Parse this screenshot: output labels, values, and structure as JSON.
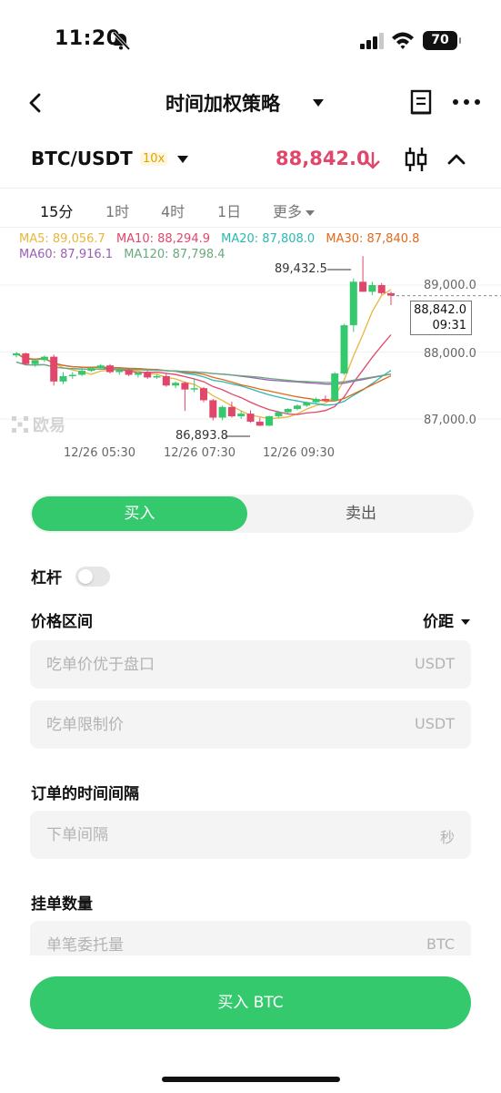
{
  "status_bar": {
    "time": "11:20",
    "battery": "70"
  },
  "nav": {
    "title": "时间加权策略"
  },
  "pair": {
    "name": "BTC/USDT",
    "leverage": "10x",
    "price": "88,842.0",
    "price_color": "#e0476b"
  },
  "timeframes": [
    "15分",
    "1时",
    "4时",
    "1日",
    "更多"
  ],
  "active_timeframe": "15分",
  "ma_legend": [
    {
      "label": "MA5: 89,056.7",
      "color": "#e8b63c"
    },
    {
      "label": "MA10: 88,294.9",
      "color": "#e0476b"
    },
    {
      "label": "MA20: 87,808.0",
      "color": "#2db8b0"
    },
    {
      "label": "MA30: 87,840.8",
      "color": "#e06a1a"
    },
    {
      "label": "MA60: 87,916.1",
      "color": "#9b5fb5"
    },
    {
      "label": "MA120: 87,798.4",
      "color": "#6aaa7c"
    }
  ],
  "chart_data": {
    "type": "candlestick",
    "pair": "BTC/USDT",
    "interval": "15分",
    "y_ticks": [
      89000.0,
      88000.0,
      87000.0
    ],
    "y_tick_labels": [
      "89,000.0",
      "88,000.0",
      "87,000.0"
    ],
    "x_tick_labels": [
      "12/26 05:30",
      "12/26 07:30",
      "12/26 09:30"
    ],
    "last_price_tag": [
      "88,842.0",
      "09:31"
    ],
    "high_marker": "89,432.5",
    "low_marker": "86,893.8",
    "up_color": "#35c96d",
    "down_color": "#e0476b",
    "candles_ohlc": [
      [
        87950,
        88000,
        87920,
        87980
      ],
      [
        87980,
        87990,
        87800,
        87820
      ],
      [
        87820,
        87900,
        87780,
        87880
      ],
      [
        87880,
        87950,
        87850,
        87930
      ],
      [
        87930,
        87960,
        87500,
        87560
      ],
      [
        87560,
        87700,
        87520,
        87640
      ],
      [
        87640,
        87700,
        87600,
        87660
      ],
      [
        87660,
        87760,
        87640,
        87720
      ],
      [
        87720,
        87780,
        87700,
        87760
      ],
      [
        87760,
        87820,
        87740,
        87800
      ],
      [
        87800,
        87820,
        87680,
        87700
      ],
      [
        87700,
        87740,
        87660,
        87730
      ],
      [
        87730,
        87760,
        87640,
        87660
      ],
      [
        87660,
        87700,
        87620,
        87690
      ],
      [
        87690,
        87720,
        87600,
        87620
      ],
      [
        87620,
        87660,
        87600,
        87640
      ],
      [
        87640,
        87680,
        87480,
        87500
      ],
      [
        87500,
        87560,
        87460,
        87540
      ],
      [
        87540,
        87560,
        87120,
        87440
      ],
      [
        87440,
        87600,
        87400,
        87460
      ],
      [
        87460,
        87480,
        87250,
        87280
      ],
      [
        87280,
        87300,
        86980,
        87020
      ],
      [
        87020,
        87200,
        86980,
        87180
      ],
      [
        87180,
        87260,
        87020,
        87040
      ],
      [
        87040,
        87120,
        87000,
        87080
      ],
      [
        87080,
        87130,
        86940,
        86960
      ],
      [
        86960,
        87020,
        86894,
        86900
      ],
      [
        86900,
        87050,
        86894,
        87040
      ],
      [
        87040,
        87120,
        87020,
        87100
      ],
      [
        87100,
        87160,
        87080,
        87150
      ],
      [
        87150,
        87220,
        87130,
        87200
      ],
      [
        87200,
        87260,
        87180,
        87250
      ],
      [
        87250,
        87320,
        87240,
        87300
      ],
      [
        87300,
        87350,
        87260,
        87280
      ],
      [
        87280,
        87700,
        87270,
        87680
      ],
      [
        87680,
        88420,
        87660,
        88400
      ],
      [
        88400,
        89100,
        88300,
        89050
      ],
      [
        89050,
        89432.5,
        88900,
        88900
      ],
      [
        88900,
        89050,
        88850,
        89000
      ],
      [
        89000,
        89030,
        88860,
        88880
      ],
      [
        88880,
        88900,
        88700,
        88842
      ]
    ]
  },
  "trade": {
    "buy_tab": "买入",
    "sell_tab": "卖出",
    "leverage_label": "杠杆",
    "price_range_label": "价格区间",
    "price_mode": "价距",
    "taker_price_placeholder": "吃单价优于盘口",
    "taker_limit_placeholder": "吃单限制价",
    "unit_usdt": "USDT",
    "interval_label": "订单的时间间隔",
    "interval_placeholder": "下单间隔",
    "interval_unit": "秒",
    "order_qty_label": "挂单数量",
    "order_qty_placeholder": "单笔委托量",
    "unit_btc": "BTC",
    "submit": "买入 BTC",
    "accent": "#35c96d"
  },
  "watermark": "欧易"
}
